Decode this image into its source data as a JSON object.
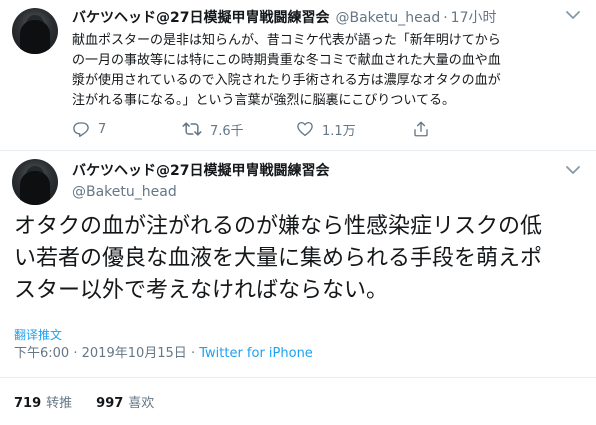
{
  "tweets": [
    {
      "display_name": "バケツヘッド@27日模擬甲冑戦闘練習会",
      "handle": "@Baketu_head",
      "separator": "·",
      "time": "17小时",
      "text_lines": [
        "献血ポスターの是非は知らんが、昔コミケ代表が語った「新年明けてから",
        "の一月の事故等には特にこの時期貴重な冬コミで献血された大量の血や血",
        "漿が使用されているので入院されたり手術される方は濃厚なオタクの血が",
        "注がれる事になる。」という言葉が強烈に脳裏にこびりついてる。"
      ],
      "actions": {
        "reply_count": "7",
        "retweet_count": "7.6千",
        "like_count": "1.1万",
        "reply_icon": "reply-icon",
        "retweet_icon": "retweet-icon",
        "like_icon": "heart-icon",
        "share_icon": "share-icon"
      }
    },
    {
      "display_name": "バケツヘッド@27日模擬甲冑戦闘練習会",
      "handle": "@Baketu_head",
      "text_lines": [
        "オタクの血が注がれるのが嫌なら性感染症リスクの低",
        "い若者の優良な血液を大量に集められる手段を萌えポ",
        "スター以外で考えなければならない。"
      ],
      "translate_label": "翻译推文",
      "time": "下午6:00",
      "separator": "·",
      "date": "2019年10月15日",
      "separator2": "·",
      "source": "Twitter for iPhone",
      "retweets": "719",
      "retweets_label": "转推",
      "likes": "997",
      "likes_label": "喜欢"
    }
  ],
  "colors": {
    "text": "#14171a",
    "secondary": "#657786",
    "accent": "#1da1f2",
    "divider": "#e6ecf0"
  }
}
